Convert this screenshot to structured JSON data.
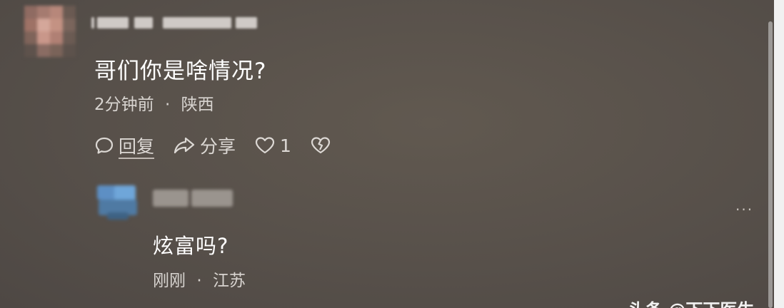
{
  "comment": {
    "text": "哥们你是啥情况?",
    "time": "2分钟前",
    "separator": "·",
    "location": "陕西",
    "actions": {
      "reply_label": "回复",
      "share_label": "分享",
      "like_count": "1"
    }
  },
  "reply": {
    "text": "炫富吗?",
    "time": "刚刚",
    "separator": "·",
    "location": "江苏",
    "more_label": "···"
  },
  "watermark": {
    "text": "头条 @下下医生"
  },
  "colors": {
    "background": "#5a5147",
    "primary_text": "#ffffff",
    "secondary_text": "#d8d4d0"
  }
}
